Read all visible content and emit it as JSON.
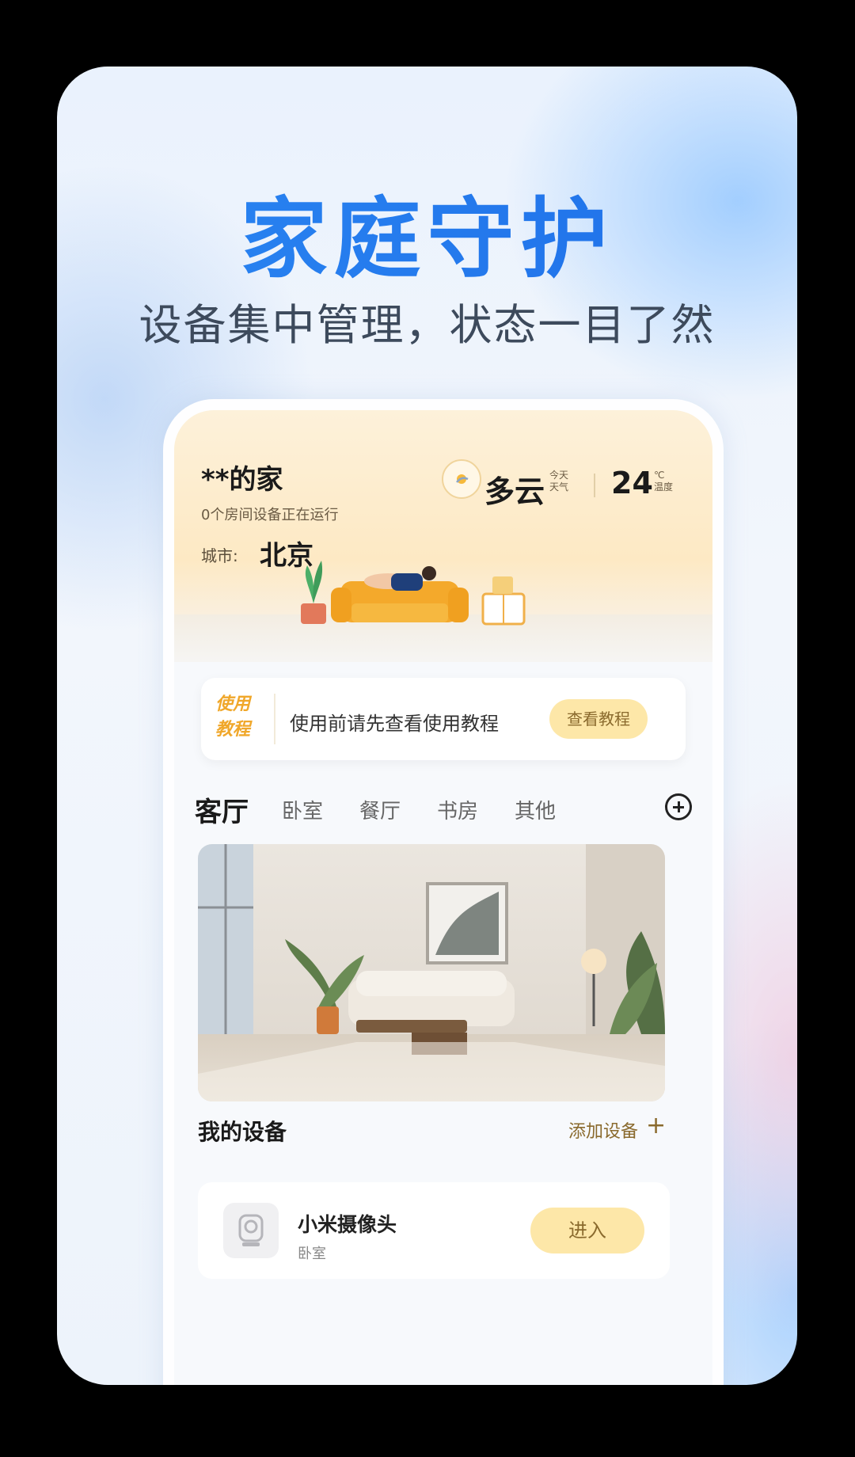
{
  "promo": {
    "headline": "家庭守护",
    "subline": "设备集中管理，状态一目了然"
  },
  "home": {
    "title": "**的家",
    "status": "0个房间设备正在运行",
    "city_label": "城市:",
    "city": "北京"
  },
  "weather": {
    "condition": "多云",
    "condition_sub": "今天\n天气",
    "temperature": "24",
    "temp_sub": "℃\n温度"
  },
  "tutorial": {
    "badge": "使用\n教程",
    "text": "使用前请先查看使用教程",
    "button": "查看教程"
  },
  "rooms": {
    "tabs": [
      "客厅",
      "卧室",
      "餐厅",
      "书房",
      "其他"
    ],
    "active_index": 0
  },
  "devices": {
    "title": "我的设备",
    "add_label": "添加设备",
    "add_symbol": "+",
    "items": [
      {
        "name": "小米摄像头",
        "room": "卧室",
        "action": "进入"
      }
    ]
  },
  "colors": {
    "accent_blue": "#2a86f2",
    "button_yellow": "#fde7a8",
    "banner_cream": "#fdf1da"
  }
}
